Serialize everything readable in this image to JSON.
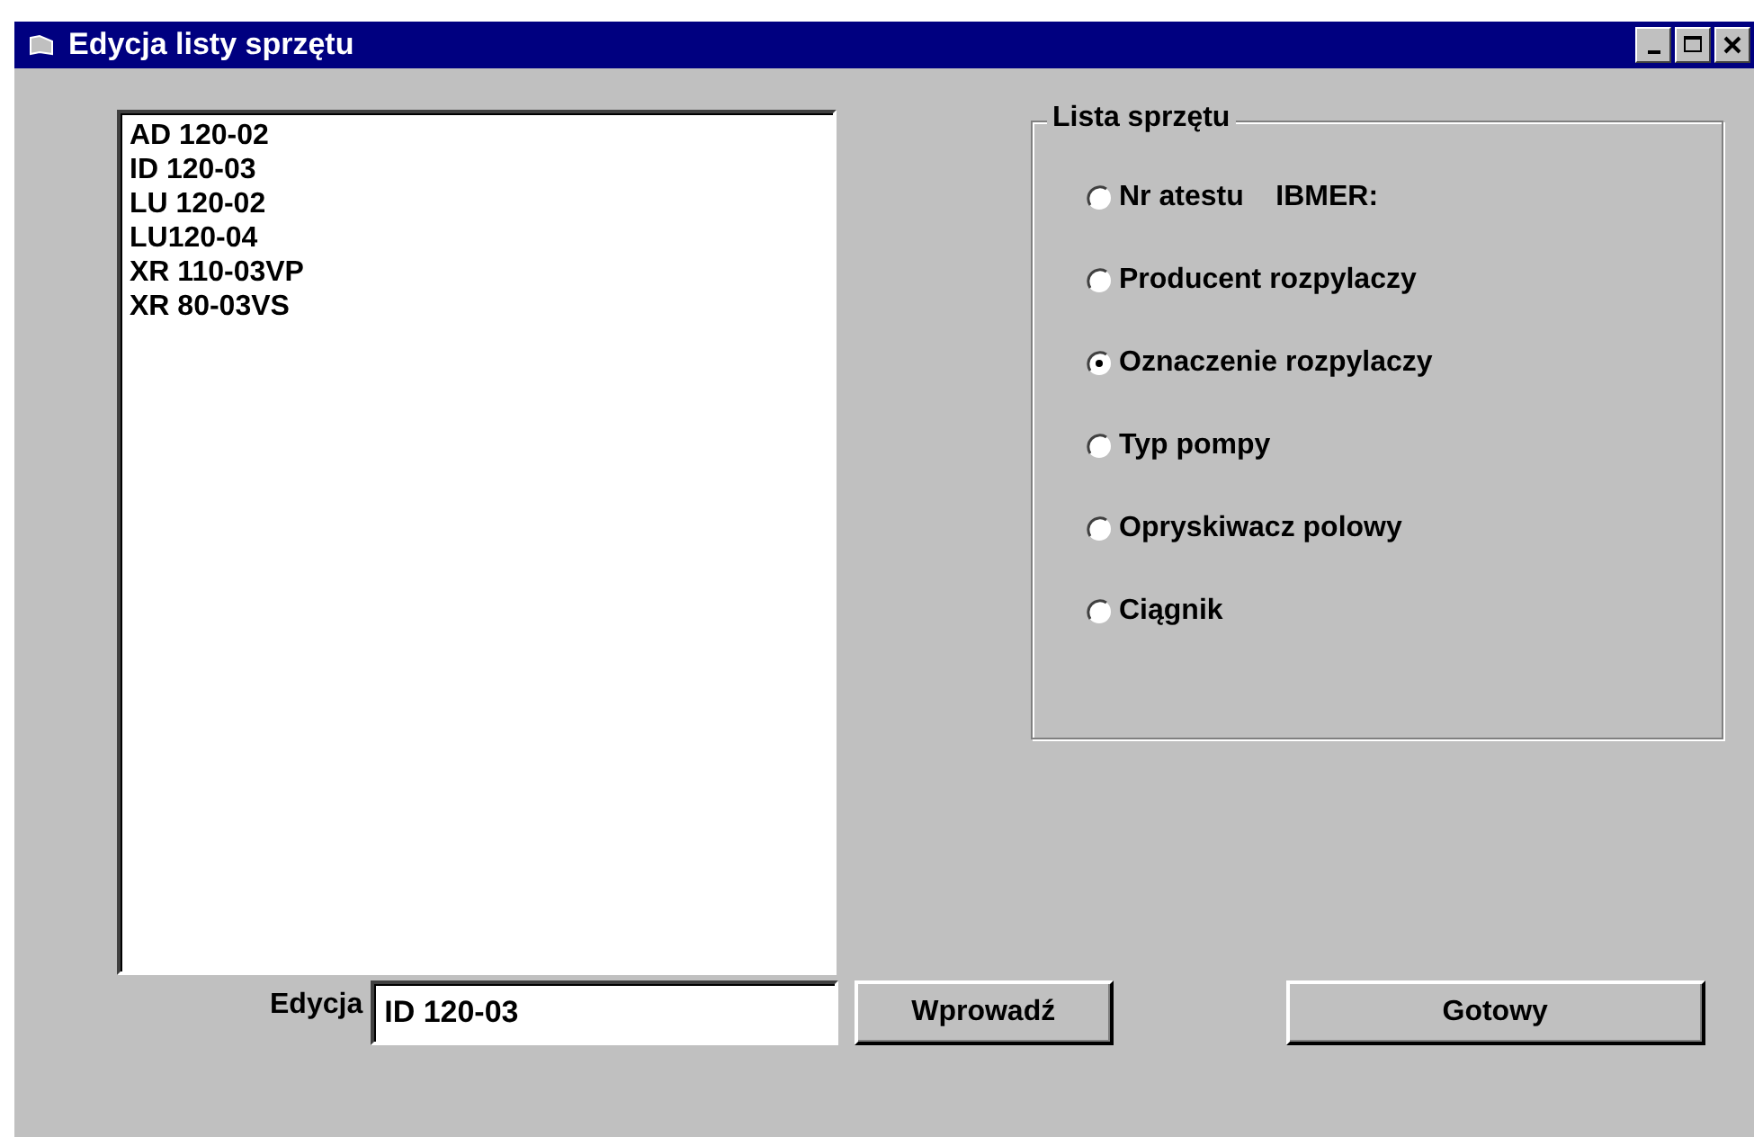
{
  "window": {
    "title": "Edycja listy sprzętu"
  },
  "list": {
    "items": [
      "AD 120-02",
      "ID 120-03",
      "LU 120-02",
      "LU120-04",
      "XR 110-03VP",
      "XR 80-03VS"
    ]
  },
  "group": {
    "title": "Lista sprzętu",
    "options": [
      {
        "label": "Nr atestu    IBMER:",
        "selected": false
      },
      {
        "label": "Producent rozpylaczy",
        "selected": false
      },
      {
        "label": "Oznaczenie rozpylaczy",
        "selected": true
      },
      {
        "label": "Typ pompy",
        "selected": false
      },
      {
        "label": "Opryskiwacz polowy",
        "selected": false
      },
      {
        "label": "Ciągnik",
        "selected": false
      }
    ]
  },
  "edit": {
    "label": "Edycja",
    "value": "ID 120-03"
  },
  "buttons": [
    {
      "kind": "enter",
      "label": "Wprowadź"
    },
    {
      "kind": "done",
      "label": "Gotowy"
    }
  ]
}
